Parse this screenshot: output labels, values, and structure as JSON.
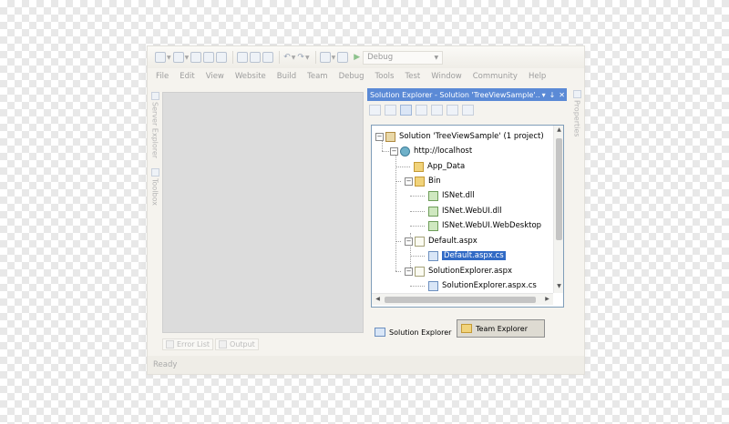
{
  "toolbar": {
    "configuration": "Debug"
  },
  "menu": {
    "items": [
      "File",
      "Edit",
      "View",
      "Website",
      "Build",
      "Team",
      "Debug",
      "Tools",
      "Test",
      "Window",
      "Community",
      "Help"
    ]
  },
  "left_panel": {
    "server_explorer": "Server Explorer",
    "toolbox": "Toolbox"
  },
  "right_panel": {
    "properties": "Properties"
  },
  "solution_explorer": {
    "title": "Solution Explorer - Solution 'TreeViewSample'...",
    "pin": "↓",
    "close": "✕",
    "tree": {
      "solution": "Solution 'TreeViewSample' (1 project)",
      "site": "http://localhost",
      "app_data": "App_Data",
      "bin": "Bin",
      "isnet_dll": "ISNet.dll",
      "isnet_webui_dll": "ISNet.WebUI.dll",
      "isnet_webdesktop": "ISNet.WebUI.WebDesktop",
      "default_aspx": "Default.aspx",
      "default_cs": "Default.aspx.cs",
      "se_aspx": "SolutionExplorer.aspx",
      "se_cs": "SolutionExplorer.aspx.cs"
    }
  },
  "bottom_tabs": {
    "solution_explorer": "Solution Explorer",
    "team_explorer": "Team Explorer"
  },
  "lower_tabs": {
    "error_list": "Error List",
    "output": "Output"
  },
  "status": {
    "text": "Ready"
  },
  "colors": {
    "title_bar": "#5b8ad6",
    "selection": "#316ac5",
    "tree_border": "#7f9db9"
  }
}
